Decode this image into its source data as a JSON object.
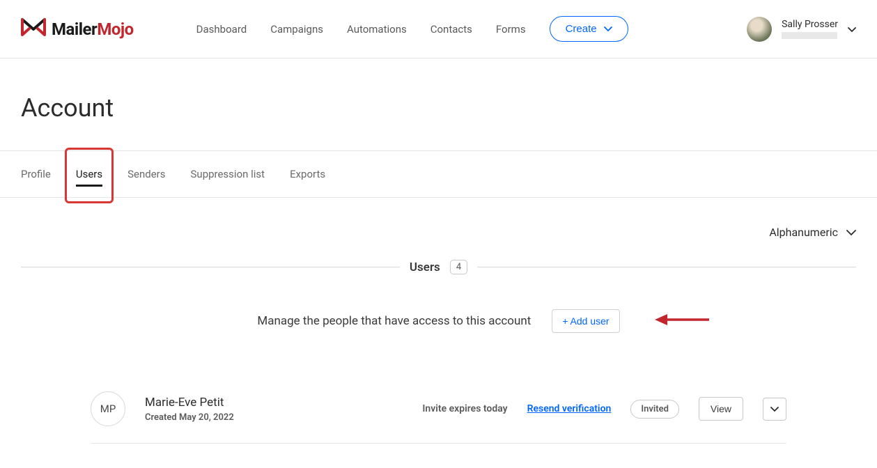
{
  "brand": {
    "part1": "Mailer",
    "part2": "Mojo"
  },
  "nav": {
    "items": [
      "Dashboard",
      "Campaigns",
      "Automations",
      "Contacts",
      "Forms"
    ],
    "create_label": "Create"
  },
  "current_user": {
    "name": "Sally Prosser"
  },
  "page": {
    "title": "Account"
  },
  "tabs": {
    "items": [
      {
        "label": "Profile",
        "active": false
      },
      {
        "label": "Users",
        "active": true
      },
      {
        "label": "Senders",
        "active": false
      },
      {
        "label": "Suppression list",
        "active": false
      },
      {
        "label": "Exports",
        "active": false
      }
    ]
  },
  "sort": {
    "label": "Alphanumeric"
  },
  "users_section": {
    "title": "Users",
    "count": "4",
    "manage_text": "Manage the people that have access to this account",
    "add_user_label": "+ Add user"
  },
  "user_list": [
    {
      "initials": "MP",
      "name": "Marie-Eve Petit",
      "created": "Created May 20, 2022",
      "invite_expires": "Invite expires today",
      "resend_label": "Resend verification",
      "status": "Invited",
      "view_label": "View"
    }
  ],
  "colors": {
    "accent_blue": "#0066ff",
    "highlight_red": "#d93636"
  }
}
